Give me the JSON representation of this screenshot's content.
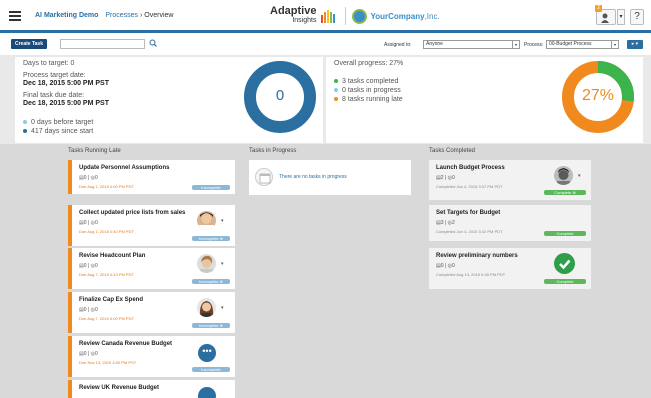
{
  "header": {
    "project": "AI Marketing Demo",
    "processes_link": "Processes",
    "separator": "›",
    "current": "Overview",
    "logo_main": "Adaptive",
    "logo_sub": "Insights",
    "company_name_bold": "Your",
    "company_name_rest": "Company",
    "company_suffix": ",Inc.",
    "notification_count": "2",
    "help": "?"
  },
  "toolbar": {
    "create_task": "Create Task",
    "search_placeholder": "",
    "assigned_label": "Assigned to:",
    "assigned_value": "Anyone",
    "process_label": "Process:",
    "process_value": "00-Budget Process",
    "go_label": "▸ ▾"
  },
  "summary": {
    "days_to_target": "Days to target: 0",
    "process_target_label": "Process target date:",
    "process_target_value": "Dec 18, 2015 5:00 PM PST",
    "final_due_label": "Final task due date:",
    "final_due_value": "Dec 18, 2015 5:00 PM PST",
    "days_before": "0 days before target",
    "days_since": "417 days since start",
    "donut_left_value": "0",
    "overall": "Overall progress: 27%",
    "completed": "3 tasks completed",
    "in_progress": "0 tasks in progress",
    "late": "8 tasks running late",
    "donut_right_value": "27%",
    "progress_fraction": 0.27,
    "colors": {
      "blue": "#2a6fa0",
      "green": "#3cb44b",
      "orange": "#f08a1e",
      "light_blue": "#8bc9e4"
    }
  },
  "columns": {
    "late_title": "Tasks Running Late",
    "progress_title": "Tasks in Progress",
    "completed_title": "Tasks Completed",
    "empty_progress": "There are no tasks in progress"
  },
  "late_tasks": [
    {
      "title": "Update Personnel Assumptions",
      "meta": "▤0  |  ◎0",
      "due": "Due Aug 1, 2015 4:00 PM PDT",
      "status": "Incomplete"
    },
    {
      "title": "Collect updated price lists from sales",
      "meta": "▤0  |  ◎0",
      "due": "Due Aug 1, 2015 4:40 PM PDT",
      "status": "Incomplete  ⊕"
    },
    {
      "title": "Revise Headcount Plan",
      "meta": "▤0  |  ◎0",
      "due": "Due Aug 7, 2015 4:43 PM PDT",
      "status": "Incomplete  ⊕"
    },
    {
      "title": "Finalize Cap Ex Spend",
      "meta": "▤0  |  ◎0",
      "due": "Due Aug 7, 2015 5:00 PM PDT",
      "status": "Incomplete  ⊕"
    },
    {
      "title": "Review Canada Revenue Budget",
      "meta": "▤0  |  ◎0",
      "due": "Due Nov 13, 2015 4:00 PM PST",
      "status": "Incomplete"
    },
    {
      "title": "Review UK Revenue Budget",
      "meta": "",
      "due": "",
      "status": ""
    }
  ],
  "completed_tasks": [
    {
      "title": "Launch Budget Process",
      "meta": "▤2  |  ◎0",
      "due": "Completed Jun 4, 2015 3:37 PM PDT",
      "status": "Complete  ⊕"
    },
    {
      "title": "Set Targets for Budget",
      "meta": "▤3  |  ◎2",
      "due": "Completed Jun 4, 2015 3:42 PM PDT",
      "status": "Complete"
    },
    {
      "title": "Review preliminary numbers",
      "meta": "▤0  |  ◎0",
      "due": "Completed Aug 14, 2015 9:45 PM PDT",
      "status": "Complete"
    }
  ]
}
